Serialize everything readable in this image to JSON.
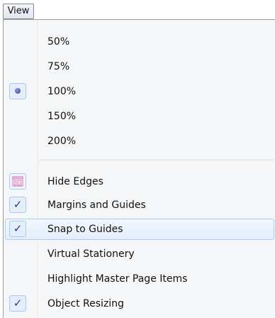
{
  "menubar": {
    "view_label": "View"
  },
  "menu": {
    "zoom_items": [
      {
        "label": "50%",
        "selected": false
      },
      {
        "label": "75%",
        "selected": false
      },
      {
        "label": "100%",
        "selected": true
      },
      {
        "label": "150%",
        "selected": false
      },
      {
        "label": "200%",
        "selected": false
      }
    ],
    "option_items": [
      {
        "label": "Hide Edges",
        "icon": "hide-edges-icon",
        "checked": false,
        "highlighted": false
      },
      {
        "label": "Margins and Guides",
        "icon": "checkmark-icon",
        "checked": true,
        "highlighted": false
      },
      {
        "label": "Snap to Guides",
        "icon": "checkmark-icon",
        "checked": true,
        "highlighted": true
      },
      {
        "label": "Virtual Stationery",
        "checked": false,
        "highlighted": false
      },
      {
        "label": "Highlight Master Page Items",
        "checked": false,
        "highlighted": false
      },
      {
        "label": "Object Resizing",
        "icon": "checkmark-icon",
        "checked": true,
        "highlighted": false
      }
    ],
    "check_glyph": "✓",
    "colors": {
      "highlight_border": "#aecbf0",
      "icon_box": "#e4eefb",
      "check": "#1d3b7a"
    }
  }
}
